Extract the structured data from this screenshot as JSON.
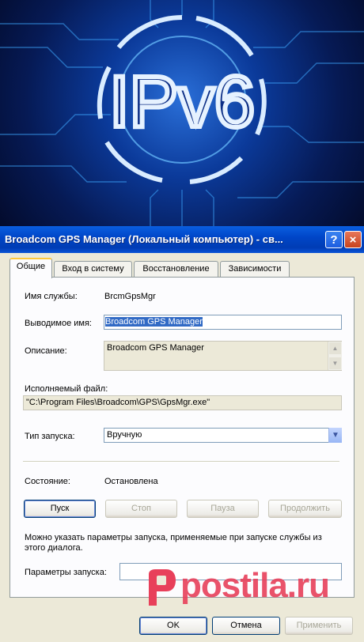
{
  "banner": {
    "text": "IPv6"
  },
  "window": {
    "title": "Broadcom GPS Manager (Локальный компьютер) - св...",
    "help_label": "?",
    "close_label": "×"
  },
  "tabs": [
    {
      "label": "Общие"
    },
    {
      "label": "Вход в систему"
    },
    {
      "label": "Восстановление"
    },
    {
      "label": "Зависимости"
    }
  ],
  "general": {
    "service_name_label": "Имя службы:",
    "service_name_value": "BrcmGpsMgr",
    "display_name_label": "Выводимое имя:",
    "display_name_value": "Broadcom GPS Manager",
    "description_label": "Описание:",
    "description_value": "Broadcom GPS Manager",
    "exe_label": "Исполняемый файл:",
    "exe_value": "\"C:\\Program Files\\Broadcom\\GPS\\GpsMgr.exe\"",
    "startup_type_label": "Тип запуска:",
    "startup_type_value": "Вручную",
    "status_label": "Состояние:",
    "status_value": "Остановлена",
    "buttons": {
      "start": "Пуск",
      "stop": "Стоп",
      "pause": "Пауза",
      "resume": "Продолжить"
    },
    "hint": "Можно указать параметры запуска, применяемые при запуске службы из этого диалога.",
    "params_label": "Параметры запуска:",
    "params_value": ""
  },
  "footer": {
    "ok": "OK",
    "cancel": "Отмена",
    "apply": "Применить"
  },
  "watermark": "postila.ru",
  "colors": {
    "titlebar": "#0046c8",
    "selection": "#316ac5",
    "watermark": "#e8405a"
  }
}
